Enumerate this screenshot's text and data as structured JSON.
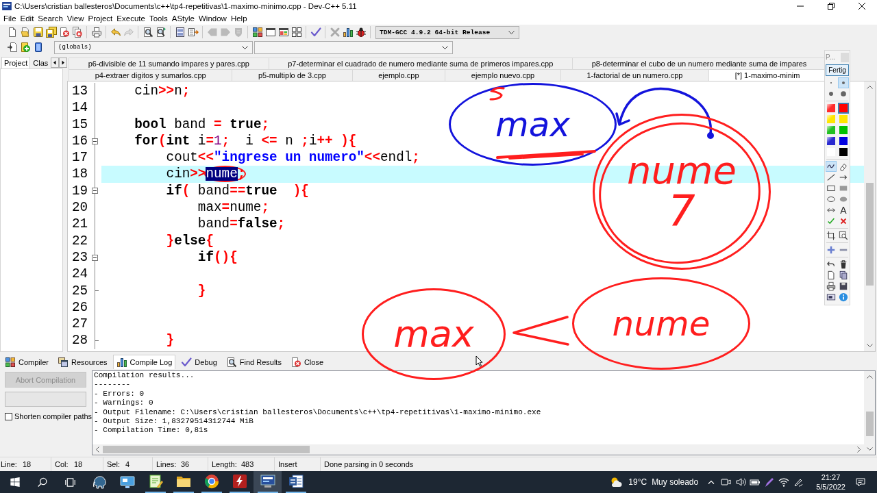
{
  "window": {
    "title": "C:\\Users\\cristian ballesteros\\Documents\\c++\\tp4-repetitivas\\1-maximo-minimo.cpp - Dev-C++ 5.11"
  },
  "menu": [
    "File",
    "Edit",
    "Search",
    "View",
    "Project",
    "Execute",
    "Tools",
    "AStyle",
    "Window",
    "Help"
  ],
  "toolbar": [
    [
      {
        "kind": "new",
        "disabled": false
      },
      {
        "kind": "open",
        "disabled": false
      },
      {
        "kind": "save",
        "disabled": false
      },
      {
        "kind": "save_all",
        "disabled": false
      },
      {
        "kind": "close",
        "disabled": false
      },
      {
        "kind": "close_all",
        "disabled": false
      }
    ],
    [
      {
        "kind": "print",
        "disabled": false
      }
    ],
    [
      {
        "kind": "undo",
        "disabled": false
      },
      {
        "kind": "redo",
        "disabled": true
      }
    ],
    [
      {
        "kind": "find",
        "disabled": false
      },
      {
        "kind": "replace",
        "disabled": false
      }
    ],
    [
      {
        "kind": "panel",
        "disabled": false
      },
      {
        "kind": "indent",
        "disabled": false
      }
    ],
    [
      {
        "kind": "tag_left",
        "disabled": true
      },
      {
        "kind": "tag_right",
        "disabled": true
      },
      {
        "kind": "shield",
        "disabled": true
      }
    ],
    [
      {
        "kind": "grid",
        "disabled": false
      },
      {
        "kind": "window",
        "disabled": false
      },
      {
        "kind": "tiled_window",
        "disabled": false
      },
      {
        "kind": "four_squares",
        "disabled": false
      }
    ],
    [
      {
        "kind": "check",
        "disabled": false
      }
    ],
    [
      {
        "kind": "cross",
        "disabled": true
      },
      {
        "kind": "bar_chart",
        "disabled": false
      },
      {
        "kind": "bug",
        "disabled": false
      }
    ]
  ],
  "compiler_select": {
    "value": "TDM-GCC 4.9.2 64-bit Release"
  },
  "toolbar_2": [
    {
      "kind": "insert"
    },
    {
      "kind": "add"
    },
    {
      "kind": "bookmark"
    }
  ],
  "scope_select": {
    "value": "(globals)"
  },
  "side_panel": {
    "tabs": [
      {
        "label": "Project",
        "selected": true
      },
      {
        "label": "Clas",
        "selected": false
      }
    ]
  },
  "editor_tabs": [
    {
      "tabs": [
        {
          "label": "p6-divisible de 11 sumando impares y pares.cpp",
          "selected": false
        },
        {
          "label": "p7-determinar el cuadrado de numero mediante suma de primeros impares.cpp",
          "selected": false
        },
        {
          "label": "p8-determinar el cubo de un numero mediante suma de impares",
          "selected": false
        }
      ]
    },
    {
      "tabs": [
        {
          "label": "p4-extraer digitos y sumarlos.cpp",
          "selected": false
        },
        {
          "label": "p5-multiplo de 3.cpp",
          "selected": false
        },
        {
          "label": "ejemplo.cpp",
          "selected": false
        },
        {
          "label": "ejemplo nuevo.cpp",
          "selected": false
        },
        {
          "label": "1-factorial de un numero.cpp",
          "selected": false
        },
        {
          "label": "[*] 1-maximo-minim",
          "selected": true
        }
      ]
    }
  ],
  "editor": {
    "lines": [
      {
        "number": "13",
        "kind": "code",
        "current": false,
        "circled": false,
        "tokens": [
          {
            "kind": "plain",
            "text": "    cin"
          },
          {
            "kind": "op",
            "text": ">>"
          },
          {
            "kind": "plain",
            "text": "n"
          },
          {
            "kind": "op",
            "text": ";"
          }
        ]
      },
      {
        "number": "14",
        "kind": "code",
        "current": false,
        "circled": false
      },
      {
        "number": "15",
        "kind": "code",
        "current": false,
        "circled": false,
        "tokens": [
          {
            "kind": "kw",
            "text": "    bool"
          },
          {
            "kind": "plain",
            "text": " band "
          },
          {
            "kind": "op",
            "text": "="
          },
          {
            "kind": "kw",
            "text": " true"
          },
          {
            "kind": "op",
            "text": ";"
          }
        ]
      },
      {
        "number": "16",
        "kind": "fold_start",
        "current": false,
        "circled": false,
        "tokens": [
          {
            "kind": "kw",
            "text": "    for"
          },
          {
            "kind": "op",
            "text": "("
          },
          {
            "kind": "kw",
            "text": "int"
          },
          {
            "kind": "plain",
            "text": " i"
          },
          {
            "kind": "op",
            "text": "="
          },
          {
            "kind": "num",
            "text": "1"
          },
          {
            "kind": "op",
            "text": ";"
          },
          {
            "kind": "plain",
            "text": "  i "
          },
          {
            "kind": "op",
            "text": "<="
          },
          {
            "kind": "plain",
            "text": " n "
          },
          {
            "kind": "op",
            "text": ";"
          },
          {
            "kind": "plain",
            "text": "i"
          },
          {
            "kind": "op",
            "text": "++"
          },
          {
            "kind": "op",
            "text": " ){"
          }
        ]
      },
      {
        "number": "17",
        "kind": "code",
        "current": false,
        "circled": false,
        "tokens": [
          {
            "kind": "plain",
            "text": "        cout"
          },
          {
            "kind": "op",
            "text": "<<"
          },
          {
            "kind": "str",
            "text": "\"ingrese un numero\""
          },
          {
            "kind": "op",
            "text": "<<"
          },
          {
            "kind": "plain",
            "text": "endl"
          },
          {
            "kind": "op",
            "text": ";"
          }
        ]
      },
      {
        "number": "18",
        "kind": "code",
        "current": true,
        "circled": true,
        "tokens": [
          {
            "kind": "plain",
            "text": "        cin"
          },
          {
            "kind": "op",
            "text": ">>"
          },
          {
            "kind": "sel",
            "text": "nume"
          },
          {
            "kind": "op",
            "text": ";"
          }
        ]
      },
      {
        "number": "19",
        "kind": "fold_start",
        "current": false,
        "circled": false,
        "tokens": [
          {
            "kind": "kw",
            "text": "        if"
          },
          {
            "kind": "op",
            "text": "("
          },
          {
            "kind": "plain",
            "text": " band"
          },
          {
            "kind": "op",
            "text": "=="
          },
          {
            "kind": "kw",
            "text": "true"
          },
          {
            "kind": "op",
            "text": "  ){"
          }
        ]
      },
      {
        "number": "20",
        "kind": "code",
        "current": false,
        "circled": false,
        "tokens": [
          {
            "kind": "plain",
            "text": "            max"
          },
          {
            "kind": "op",
            "text": "="
          },
          {
            "kind": "plain",
            "text": "nume"
          },
          {
            "kind": "op",
            "text": ";"
          }
        ]
      },
      {
        "number": "21",
        "kind": "code",
        "current": false,
        "circled": false,
        "tokens": [
          {
            "kind": "plain",
            "text": "            band"
          },
          {
            "kind": "op",
            "text": "="
          },
          {
            "kind": "kw",
            "text": "false"
          },
          {
            "kind": "op",
            "text": ";"
          }
        ]
      },
      {
        "number": "22",
        "kind": "code",
        "current": false,
        "circled": false,
        "tokens": [
          {
            "kind": "op",
            "text": "        }"
          },
          {
            "kind": "kw",
            "text": "else"
          },
          {
            "kind": "op",
            "text": "{"
          }
        ]
      },
      {
        "number": "23",
        "kind": "fold_start",
        "current": false,
        "circled": false,
        "tokens": [
          {
            "kind": "kw",
            "text": "            if"
          },
          {
            "kind": "op",
            "text": "(){"
          }
        ]
      },
      {
        "number": "24",
        "kind": "code",
        "current": false,
        "circled": false
      },
      {
        "number": "25",
        "kind": "fold_end",
        "current": false,
        "circled": false,
        "tokens": [
          {
            "kind": "op",
            "text": "            }"
          }
        ]
      },
      {
        "number": "26",
        "kind": "code",
        "current": false,
        "circled": false
      },
      {
        "number": "27",
        "kind": "code",
        "current": false,
        "circled": false
      },
      {
        "number": "28",
        "kind": "fold_end",
        "current": false,
        "circled": false,
        "tokens": [
          {
            "kind": "op",
            "text": "        }"
          }
        ]
      }
    ]
  },
  "bottom_tabs": [
    {
      "label": "Compiler",
      "kind": "grid",
      "selected": false
    },
    {
      "label": "Resources",
      "kind": "windows",
      "selected": false
    },
    {
      "label": "Compile Log",
      "kind": "bar_chart",
      "selected": true
    },
    {
      "label": "Debug",
      "kind": "check",
      "selected": false
    },
    {
      "label": "Find Results",
      "kind": "find",
      "selected": false
    },
    {
      "label": "Close",
      "kind": "close",
      "selected": false
    }
  ],
  "compile_panel": {
    "abort_button": {
      "label": "Abort Compilation",
      "disabled": true
    },
    "shorten_paths": {
      "label": "Shorten compiler paths",
      "checked": false
    },
    "log": [
      "Compilation results...",
      "--------",
      "- Errors: 0",
      "- Warnings: 0",
      "- Output Filename: C:\\Users\\cristian ballesteros\\Documents\\c++\\tp4-repetitivas\\1-maximo-minimo.exe",
      "- Output Size: 1,83279514312744 MiB",
      "- Compilation Time: 0,81s"
    ]
  },
  "status_bar": [
    {
      "label": "Line:",
      "value": "18"
    },
    {
      "label": "Col:",
      "value": "18"
    },
    {
      "label": "Sel:",
      "value": "4"
    },
    {
      "label": "Lines:",
      "value": "36"
    },
    {
      "label": "Length:",
      "value": "483"
    },
    {
      "value": "Insert"
    },
    {
      "value": "Done parsing in 0 seconds"
    }
  ],
  "pen_palette": {
    "title": "P...",
    "done_button": "Fertig",
    "sizes": [
      {
        "selected": false
      },
      {
        "selected": true
      },
      {
        "selected": false
      },
      {
        "selected": false
      }
    ],
    "colors": [
      {
        "color": "#ff2a2a",
        "kind": "highlighter",
        "selected": false
      },
      {
        "color": "#ff0000",
        "kind": "pen",
        "selected": true
      },
      {
        "color": "#ffe600",
        "kind": "highlighter",
        "selected": false
      },
      {
        "color": "#ffe600",
        "kind": "pen",
        "selected": false
      },
      {
        "color": "#22c022",
        "kind": "highlighter",
        "selected": false
      },
      {
        "color": "#00c000",
        "kind": "pen",
        "selected": false
      },
      {
        "color": "#2a2ad0",
        "kind": "highlighter",
        "selected": false
      },
      {
        "color": "#0000e0",
        "kind": "pen",
        "selected": false
      },
      {
        "color": "#ffffff",
        "kind": "pen",
        "selected": false
      },
      {
        "color": "#000000",
        "kind": "pen",
        "selected": false
      }
    ],
    "tool_groups": [
      [
        {
          "kind": "freehand",
          "selected": true
        },
        {
          "kind": "eraser",
          "selected": false
        },
        {
          "kind": "line",
          "selected": false
        },
        {
          "kind": "arrow",
          "selected": false
        },
        {
          "kind": "rectangle",
          "selected": false
        },
        {
          "kind": "filled_rectangle",
          "selected": false
        },
        {
          "kind": "ellipse",
          "selected": false
        },
        {
          "kind": "filled_ellipse",
          "selected": false
        },
        {
          "kind": "double_arrow",
          "selected": false
        },
        {
          "kind": "text",
          "glyph": "A",
          "selected": false
        },
        {
          "kind": "check",
          "selected": false
        },
        {
          "kind": "cross",
          "selected": false
        }
      ],
      [
        {
          "kind": "crop",
          "selected": false
        },
        {
          "kind": "zoom",
          "selected": false
        }
      ],
      [
        {
          "kind": "plus",
          "selected": false
        },
        {
          "kind": "minus",
          "selected": false
        }
      ],
      [
        {
          "kind": "undo",
          "selected": false
        },
        {
          "kind": "delete",
          "selected": false
        },
        {
          "kind": "new_page",
          "selected": false
        },
        {
          "kind": "copy",
          "selected": false
        },
        {
          "kind": "print",
          "selected": false
        },
        {
          "kind": "save",
          "selected": false
        },
        {
          "kind": "screen",
          "selected": false
        },
        {
          "kind": "info",
          "selected": false
        }
      ]
    ]
  },
  "ink": [
    {
      "kind": "loop",
      "color": "#1414dc",
      "lines": [
        "max"
      ]
    },
    {
      "kind": "squiggle",
      "color": "#ff1e1e"
    },
    {
      "kind": "scribble",
      "color": "#ff1e1e"
    },
    {
      "kind": "curved_arrow",
      "color": "#1414dc"
    },
    {
      "kind": "loop",
      "color": "#ff1e1e",
      "lines": [
        "nume",
        "7"
      ]
    },
    {
      "kind": "loop",
      "color": "#ff1e1e",
      "lines": [
        "max"
      ]
    },
    {
      "kind": "arrow",
      "color": "#ff1e1e"
    },
    {
      "kind": "loop",
      "color": "#ff1e1e",
      "lines": [
        "nume"
      ]
    }
  ],
  "taskbar": {
    "apps": [
      {
        "kind": "start",
        "running": false,
        "active": false
      },
      {
        "kind": "search",
        "running": false,
        "active": false
      },
      {
        "kind": "task_view",
        "running": false,
        "active": false
      },
      {
        "kind": "elephant",
        "running": false,
        "active": false
      },
      {
        "kind": "monitor",
        "running": false,
        "active": false
      },
      {
        "kind": "notepad",
        "running": true,
        "active": false
      },
      {
        "kind": "folder",
        "running": true,
        "active": false
      },
      {
        "kind": "browser",
        "running": true,
        "active": false
      },
      {
        "kind": "lightning_tile",
        "running": true,
        "active": false
      },
      {
        "kind": "dev_monitor",
        "running": true,
        "active": true
      },
      {
        "kind": "document_tile",
        "running": true,
        "active": false
      }
    ],
    "weather": {
      "temperature": "19°C",
      "condition": "Muy soleado"
    },
    "clock": {
      "time": "21:27",
      "date": "5/5/2022"
    }
  }
}
